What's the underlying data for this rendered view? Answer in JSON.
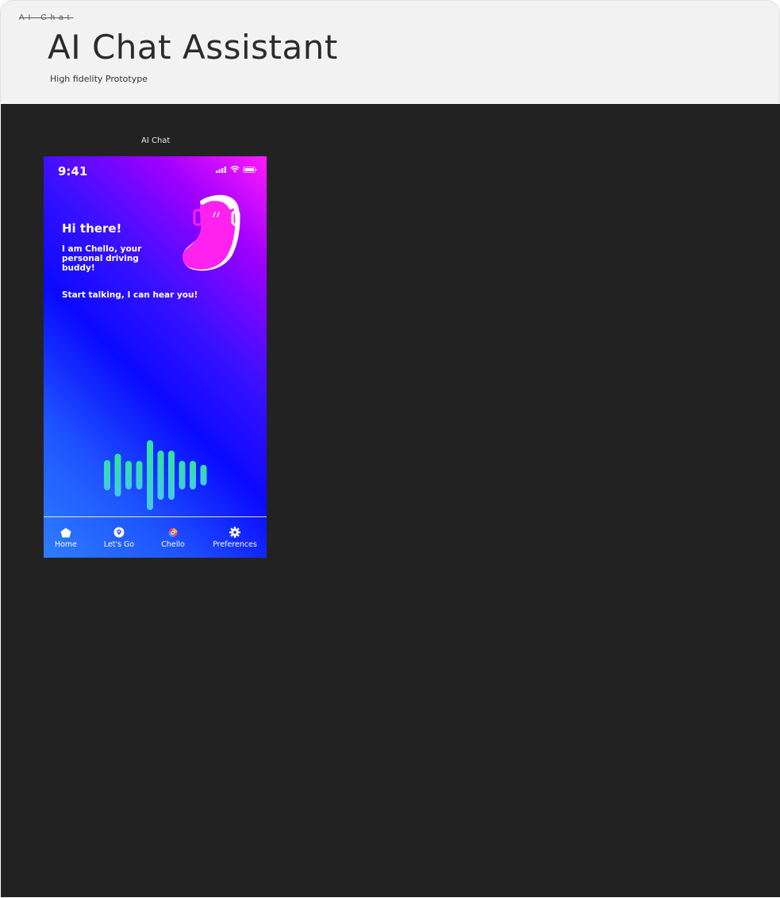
{
  "header": {
    "page_tab": "AI Chat",
    "title": "AI Chat Assistant",
    "subtitle": "High fidelity Prototype"
  },
  "canvas": {
    "frame_label": "AI Chat"
  },
  "phone": {
    "status_bar": {
      "time": "9:41"
    },
    "greeting": "Hi there!",
    "intro": "I am Chello, your personal driving buddy!",
    "prompt": "Start talking, I can hear you!",
    "tabs": [
      {
        "label": "Home",
        "icon": "home-icon"
      },
      {
        "label": "Let's Go",
        "icon": "location-pin-icon"
      },
      {
        "label": "Chello",
        "icon": "chello-logo-icon"
      },
      {
        "label": "Preferences",
        "icon": "gear-icon"
      }
    ]
  },
  "colors": {
    "header_bg": "#f2f2f2",
    "canvas_bg": "#222222",
    "gradient_pink": "#ff1aff",
    "gradient_blue": "#0a0aff",
    "gradient_light_blue": "#2e7dff",
    "mascot": "#ff22ee",
    "wave_green": "#2fe59a",
    "wave_teal": "#47c8e8"
  }
}
